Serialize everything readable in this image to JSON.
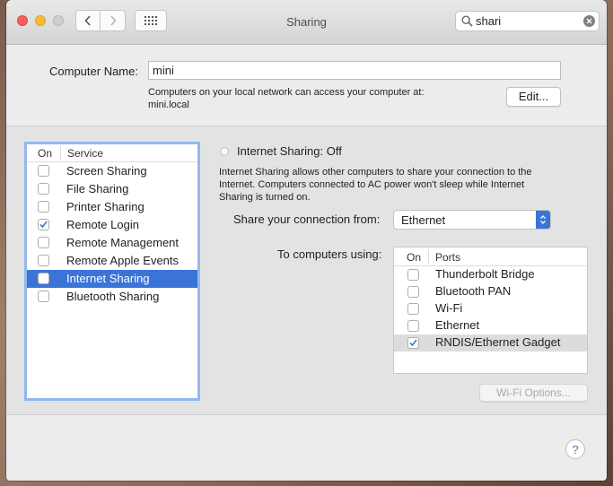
{
  "window": {
    "title": "Sharing"
  },
  "search": {
    "value": "shari"
  },
  "computer_name": {
    "label": "Computer Name:",
    "value": "mini",
    "desc_line1": "Computers on your local network can access your computer at:",
    "desc_line2": "mini.local",
    "edit_label": "Edit..."
  },
  "services": {
    "col_on": "On",
    "col_service": "Service",
    "items": [
      {
        "label": "Screen Sharing",
        "checked": false,
        "selected": false
      },
      {
        "label": "File Sharing",
        "checked": false,
        "selected": false
      },
      {
        "label": "Printer Sharing",
        "checked": false,
        "selected": false
      },
      {
        "label": "Remote Login",
        "checked": true,
        "selected": false
      },
      {
        "label": "Remote Management",
        "checked": false,
        "selected": false
      },
      {
        "label": "Remote Apple Events",
        "checked": false,
        "selected": false
      },
      {
        "label": "Internet Sharing",
        "checked": false,
        "selected": true
      },
      {
        "label": "Bluetooth Sharing",
        "checked": false,
        "selected": false
      }
    ]
  },
  "internet_sharing": {
    "title": "Internet Sharing: Off",
    "desc_line1": "Internet Sharing allows other computers to share your connection to the",
    "desc_line2": "Internet. Computers connected to AC power won't sleep while Internet",
    "desc_line3": "Sharing is turned on.",
    "share_from_label": "Share your connection from:",
    "share_from_value": "Ethernet",
    "to_label": "To computers using:",
    "col_on": "On",
    "col_ports": "Ports",
    "ports": [
      {
        "label": "Thunderbolt Bridge",
        "checked": false
      },
      {
        "label": "Bluetooth PAN",
        "checked": false
      },
      {
        "label": "Wi-Fi",
        "checked": false
      },
      {
        "label": "Ethernet",
        "checked": false
      },
      {
        "label": "RNDIS/Ethernet Gadget",
        "checked": true
      }
    ],
    "wifi_options_label": "Wi-Fi Options..."
  },
  "help": {
    "glyph": "?"
  },
  "colors": {
    "accent": "#3b74d7",
    "close": "#fc5f57",
    "minimize": "#fdbc2e"
  }
}
